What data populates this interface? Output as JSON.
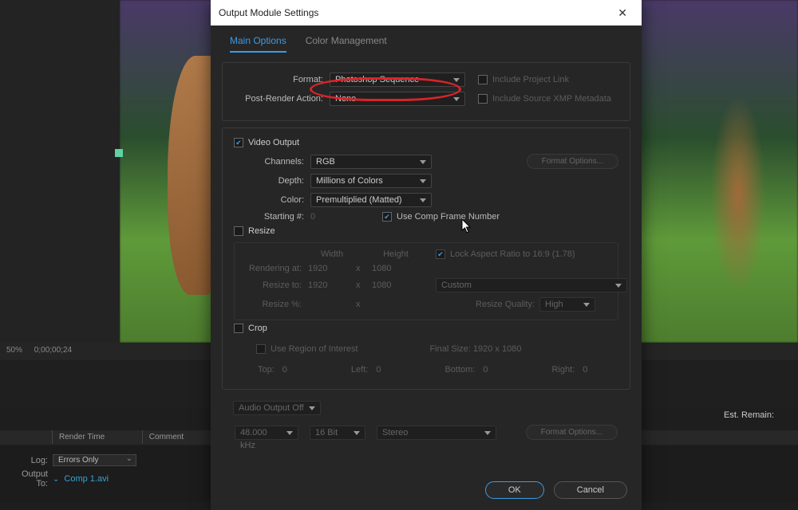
{
  "dialog": {
    "title": "Output Module Settings",
    "tabs": {
      "main": "Main Options",
      "color": "Color Management"
    },
    "format_label": "Format:",
    "format_value": "Photoshop Sequence",
    "include_project_link": "Include Project Link",
    "post_render_label": "Post-Render Action:",
    "post_render_value": "None",
    "include_xmp": "Include Source XMP Metadata",
    "video_output": "Video Output",
    "channels_label": "Channels:",
    "channels_value": "RGB",
    "format_options_btn": "Format Options...",
    "depth_label": "Depth:",
    "depth_value": "Millions of Colors",
    "color_label": "Color:",
    "color_value": "Premultiplied (Matted)",
    "starting_label": "Starting #:",
    "starting_value": "0",
    "use_comp_frame": "Use Comp Frame Number",
    "resize": "Resize",
    "width_h": "Width",
    "height_h": "Height",
    "lock_aspect": "Lock Aspect Ratio to 16:9 (1.78)",
    "rendering_at": "Rendering at:",
    "rw": "1920",
    "rh": "1080",
    "resize_to": "Resize to:",
    "tw": "1920",
    "th": "1080",
    "preset": "Custom",
    "resize_pct": "Resize %:",
    "resize_quality_label": "Resize Quality:",
    "resize_quality": "High",
    "x": "x",
    "crop": "Crop",
    "use_roi": "Use Region of Interest",
    "final_size": "Final Size: 1920 x 1080",
    "top": "Top:",
    "left": "Left:",
    "bottom": "Bottom:",
    "right": "Right:",
    "zero": "0",
    "audio_off": "Audio Output Off",
    "audio_hz": "48.000 kHz",
    "audio_bit": "16 Bit",
    "audio_ch": "Stereo",
    "ok": "OK",
    "cancel": "Cancel"
  },
  "bottom": {
    "zoom": "50%",
    "timecode": "0;00;00;24",
    "est_remain": "Est. Remain:",
    "render_time": "Render Time",
    "comment": "Comment",
    "log_label": "Log:",
    "log_value": "Errors Only",
    "output_to": "Output To:",
    "output_link": "Comp 1.avi"
  }
}
